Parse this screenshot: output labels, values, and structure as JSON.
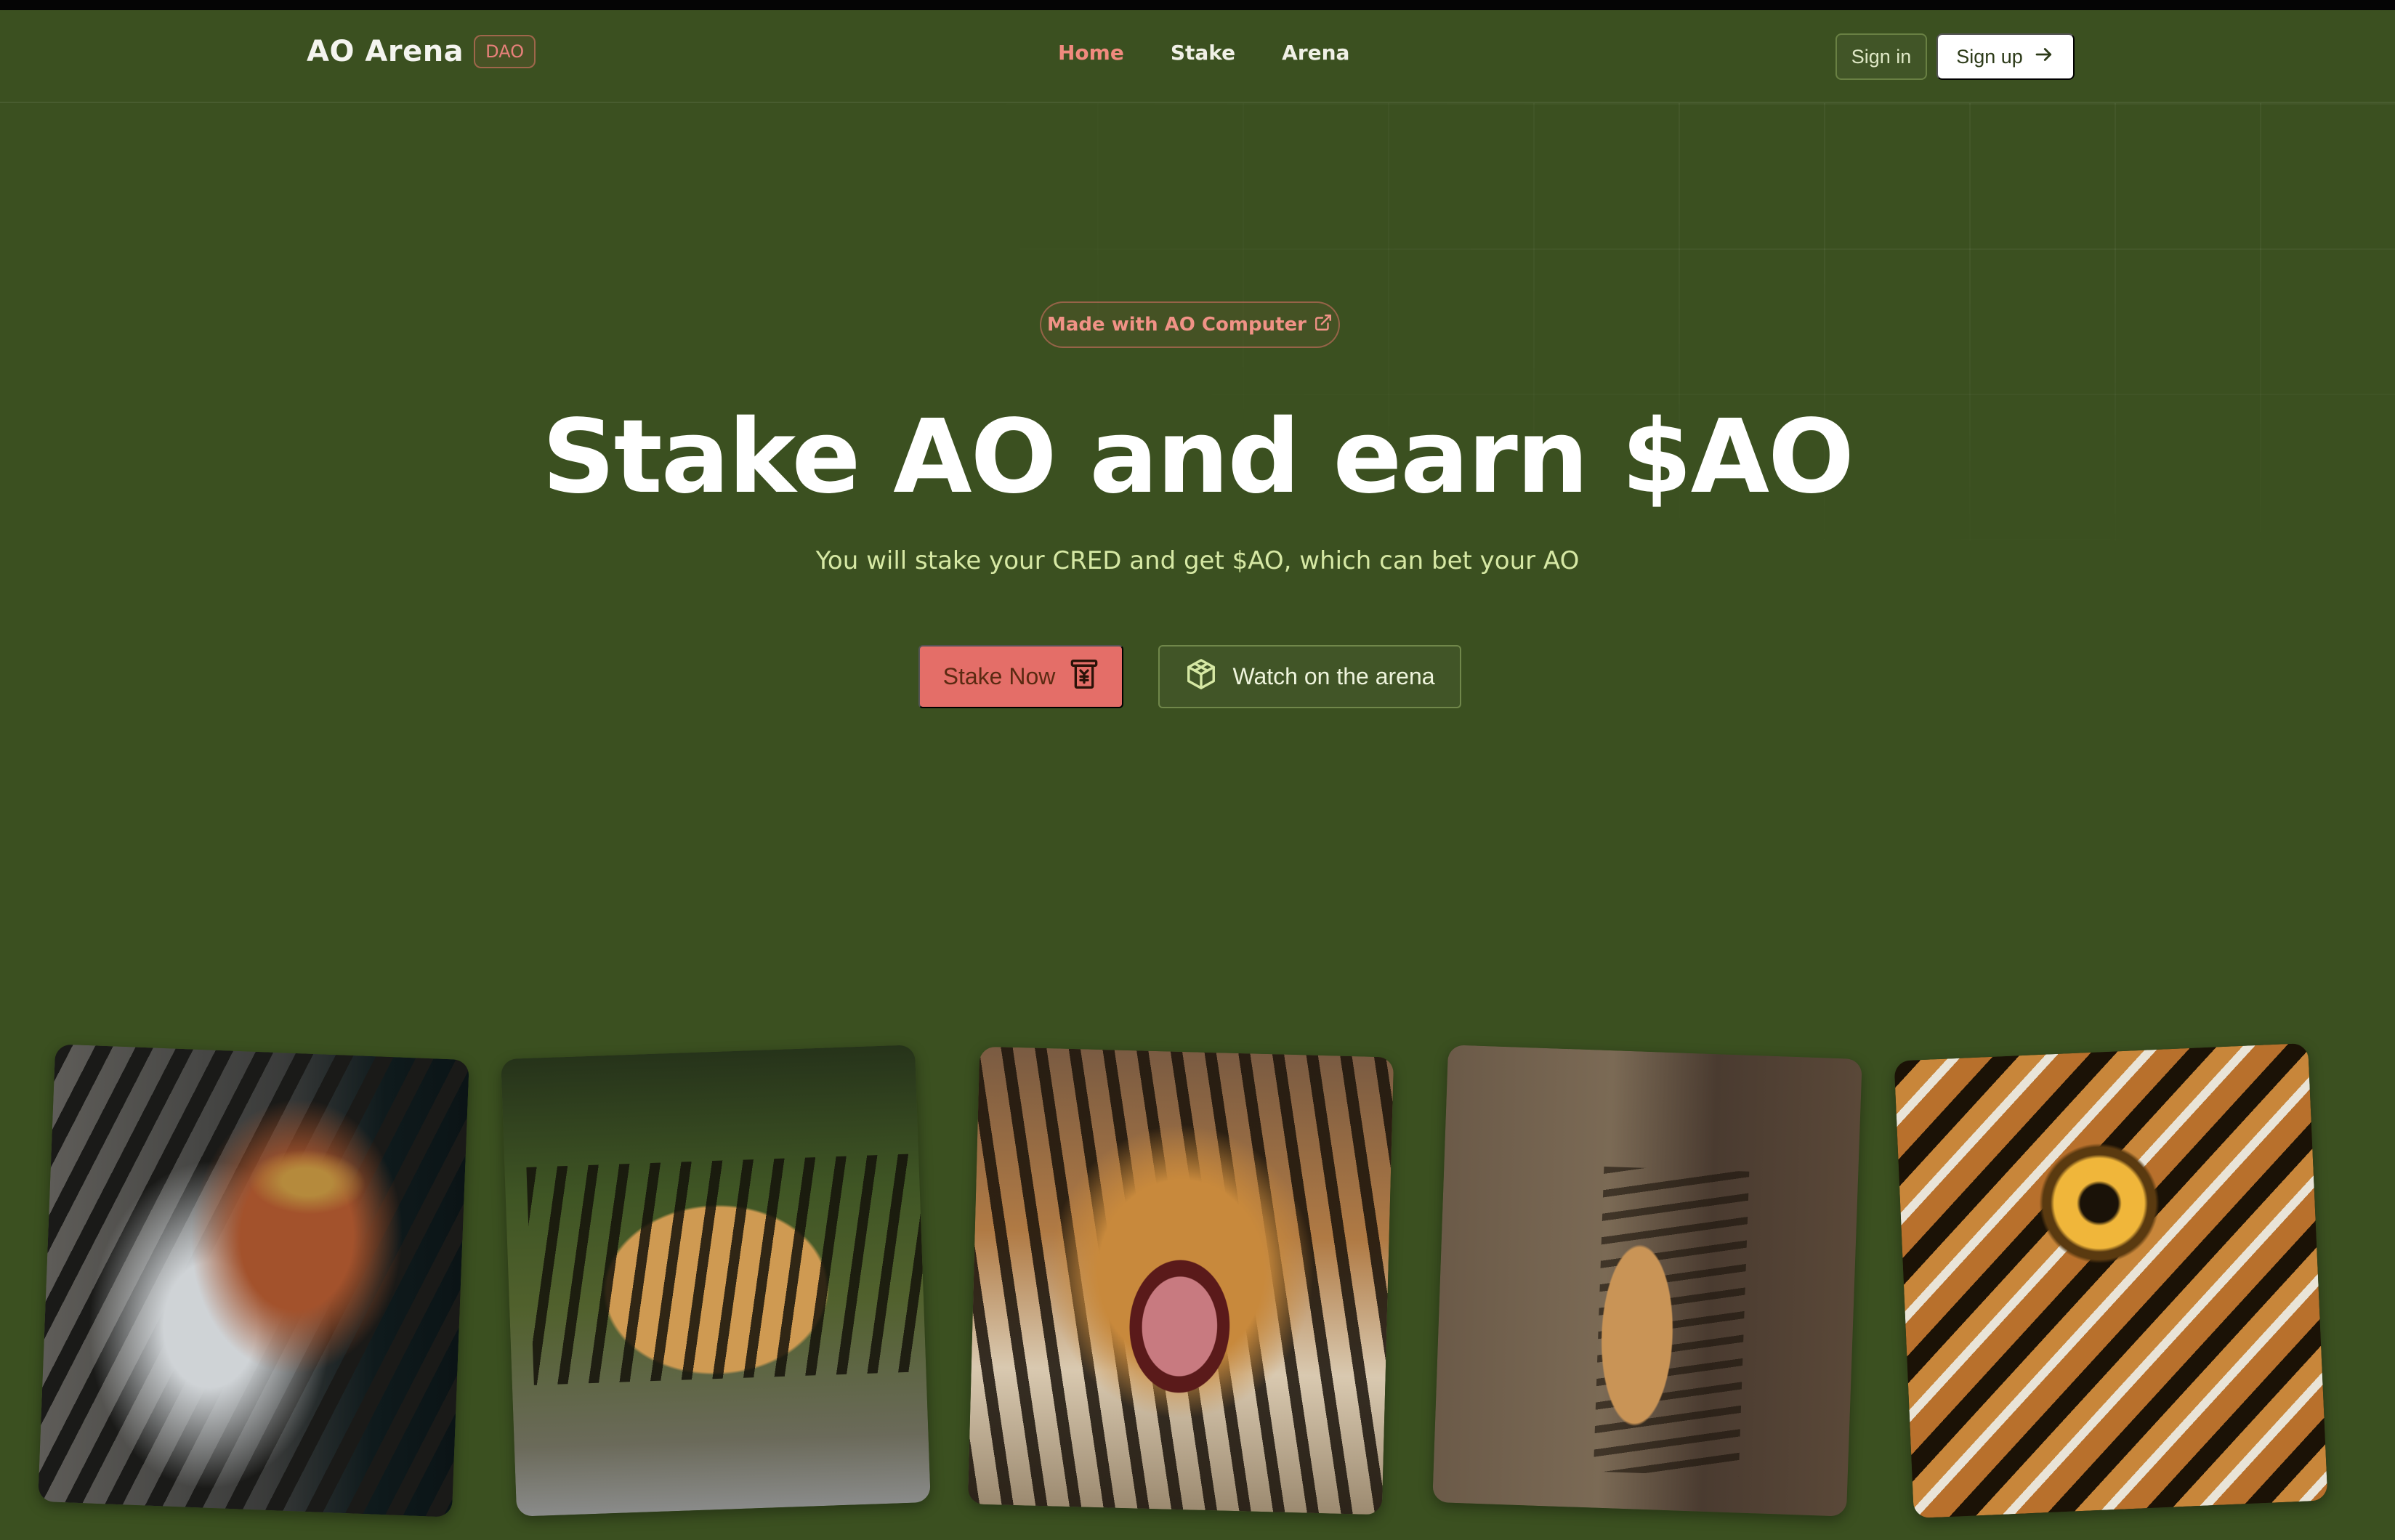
{
  "brand": {
    "title": "AO Arena",
    "badge": "DAO"
  },
  "nav": {
    "items": [
      {
        "label": "Home",
        "active": true
      },
      {
        "label": "Stake",
        "active": false
      },
      {
        "label": "Arena",
        "active": false
      }
    ]
  },
  "auth": {
    "signin": "Sign in",
    "signup": "Sign up"
  },
  "hero": {
    "pill": "Made with AO Computer",
    "title": "Stake AO and earn $AO",
    "subtitle": "You will stake your CRED and get $AO, which can bet your AO",
    "cta_primary": "Stake Now",
    "cta_secondary": "Watch on the arena"
  },
  "gallery": {
    "items": [
      {
        "name": "tiger-profile-photo"
      },
      {
        "name": "tiger-walking-photo"
      },
      {
        "name": "tiger-roaring-photo"
      },
      {
        "name": "tiger-sitting-photo"
      },
      {
        "name": "tiger-eye-photo"
      }
    ]
  },
  "colors": {
    "background": "#3b5020",
    "accent": "#e46e68",
    "accent_text": "#f08a7e",
    "subtitle": "#d6e8a4"
  },
  "icons": {
    "pill": "external-link-icon",
    "signup": "arrow-right-icon",
    "stake": "vending-machine-icon",
    "watch": "box-3d-icon"
  }
}
